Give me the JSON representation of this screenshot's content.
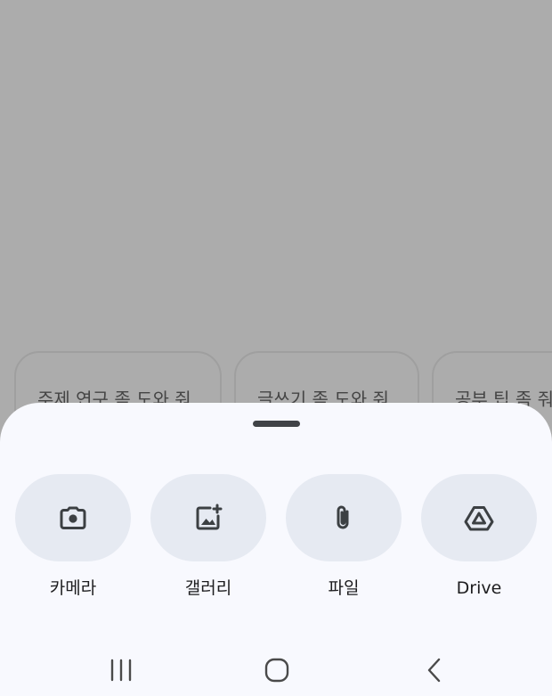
{
  "background_chips": [
    {
      "label": "주제 연구 좀 도와 줘"
    },
    {
      "label": "글쓰기 좀 도와 줘"
    },
    {
      "label": "공부 팁 좀 줘"
    }
  ],
  "sheet": {
    "options": [
      {
        "label": "카메라",
        "icon": "camera-icon"
      },
      {
        "label": "갤러리",
        "icon": "add-image-icon"
      },
      {
        "label": "파일",
        "icon": "paperclip-icon"
      },
      {
        "label": "Drive",
        "icon": "drive-icon"
      }
    ]
  },
  "navigation": {
    "buttons": [
      "recents-icon",
      "home-icon",
      "back-icon"
    ]
  },
  "colors": {
    "scrim": "#acacac",
    "sheet_background": "#f8f9fe",
    "option_background": "#e6eaf2",
    "icon": "#3c4043"
  }
}
